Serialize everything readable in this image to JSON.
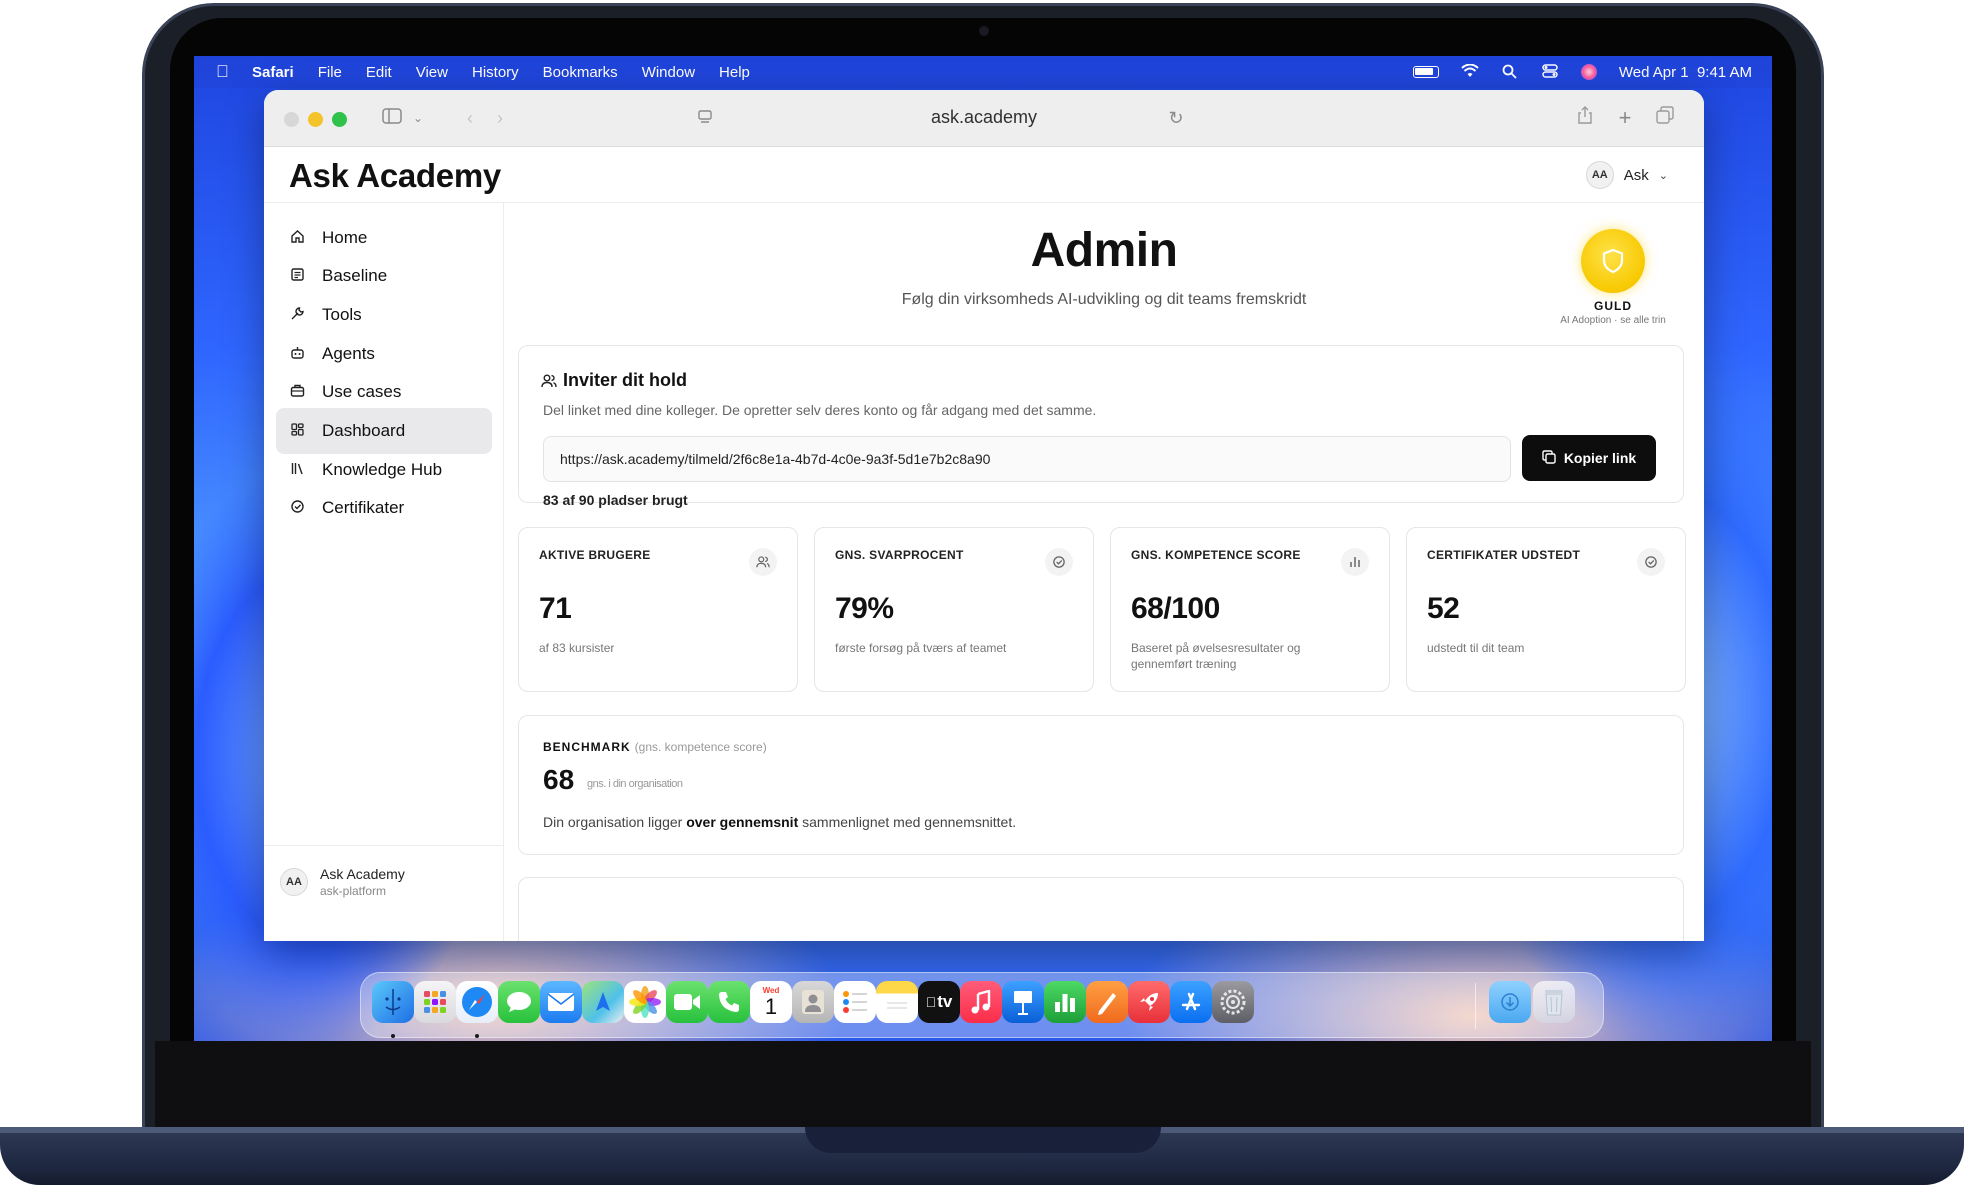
{
  "menubar": {
    "app_name": "Safari",
    "menus": [
      "File",
      "Edit",
      "View",
      "History",
      "Bookmarks",
      "Window",
      "Help"
    ],
    "datetime": "Wed Apr 1  9:41 AM"
  },
  "browser": {
    "url": "ask.academy"
  },
  "app": {
    "brand": "Ask Academy",
    "user": {
      "initials": "AA",
      "name": "Ask"
    }
  },
  "sidebar": {
    "items": [
      {
        "label": "Home",
        "icon": "home-icon"
      },
      {
        "label": "Baseline",
        "icon": "document-icon"
      },
      {
        "label": "Tools",
        "icon": "wrench-icon"
      },
      {
        "label": "Agents",
        "icon": "robot-icon"
      },
      {
        "label": "Use cases",
        "icon": "briefcase-icon"
      },
      {
        "label": "Dashboard",
        "icon": "grid-icon",
        "active": true
      },
      {
        "label": "Knowledge Hub",
        "icon": "library-icon"
      },
      {
        "label": "Certifikater",
        "icon": "check-circle-icon"
      }
    ],
    "footer": {
      "initials": "AA",
      "name": "Ask Academy",
      "sub": "ask-platform"
    }
  },
  "page": {
    "title": "Admin",
    "subtitle": "Følg din virksomheds AI-udvikling og dit teams fremskridt",
    "badge": {
      "label": "GULD",
      "sub": "AI Adoption · se alle trin",
      "color": "#f7c900"
    }
  },
  "invite": {
    "title": "Inviter dit hold",
    "description": "Del linket med dine kolleger. De opretter selv deres konto og får adgang med det samme.",
    "link": "https://ask.academy/tilmeld/2f6c8e1a-4b7d-4c0e-9a3f-5d1e7b2c8a90",
    "copy_label": "Kopier link",
    "seats": "83 af 90 pladser brugt"
  },
  "stats": [
    {
      "label": "AKTIVE BRUGERE",
      "value": "71",
      "desc": "af 83 kursister",
      "icon": "users-icon"
    },
    {
      "label": "GNS. SVARPROCENT",
      "value": "79%",
      "desc": "første forsøg på tværs af teamet",
      "icon": "check-circle-icon"
    },
    {
      "label": "GNS. KOMPETENCE SCORE",
      "value": "68/100",
      "desc": "Baseret på øvelsesresultater og gennemført træning",
      "icon": "bar-chart-icon"
    },
    {
      "label": "CERTIFIKATER UDSTEDT",
      "value": "52",
      "desc": "udstedt til dit team",
      "icon": "badge-icon"
    }
  ],
  "benchmark": {
    "label": "BENCHMARK",
    "label_sub": "(gns. kompetence score)",
    "value": "68",
    "value_sub": "gns. i din organisation",
    "text_pre": "Din organisation ligger ",
    "text_bold": "over gennemsnit",
    "text_post": " sammenlignet med gennemsnittet."
  },
  "dock": {
    "calendar_month": "Wed",
    "calendar_day": "1",
    "tv_label": "tv"
  }
}
